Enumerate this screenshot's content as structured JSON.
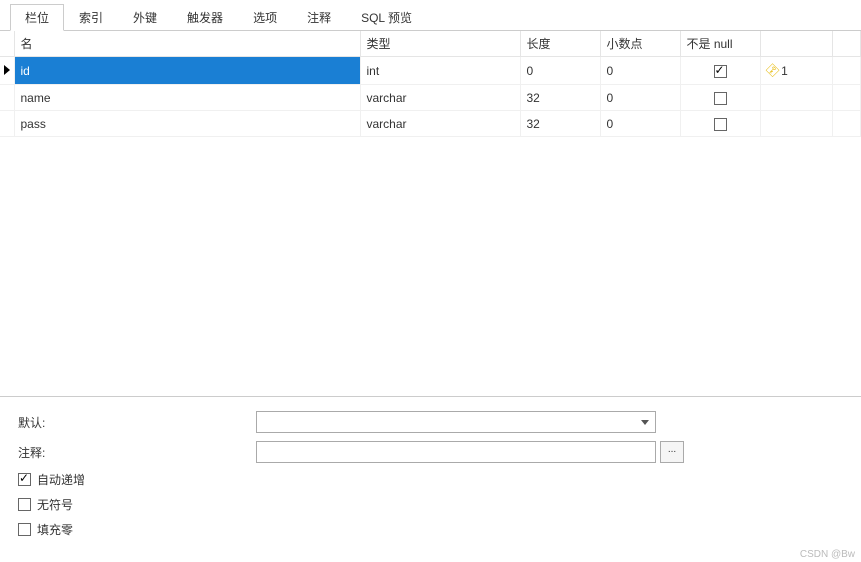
{
  "tabs": {
    "fields": "栏位",
    "indexes": "索引",
    "fk": "外键",
    "triggers": "触发器",
    "options": "选项",
    "comments": "注释",
    "sql": "SQL 预览"
  },
  "columns": {
    "name": "名",
    "type": "类型",
    "length": "长度",
    "decimals": "小数点",
    "notnull": "不是 null"
  },
  "rows": [
    {
      "name": "id",
      "type": "int",
      "length": "0",
      "decimals": "0",
      "notnull": true,
      "primary_key_order": "1",
      "selected": true
    },
    {
      "name": "name",
      "type": "varchar",
      "length": "32",
      "decimals": "0",
      "notnull": false,
      "primary_key_order": "",
      "selected": false
    },
    {
      "name": "pass",
      "type": "varchar",
      "length": "32",
      "decimals": "0",
      "notnull": false,
      "primary_key_order": "",
      "selected": false
    }
  ],
  "details": {
    "default_label": "默认:",
    "default_value": "",
    "comment_label": "注释:",
    "comment_value": "",
    "more_label": "...",
    "auto_increment_label": "自动递增",
    "auto_increment": true,
    "unsigned_label": "无符号",
    "unsigned": false,
    "zerofill_label": "填充零",
    "zerofill": false
  },
  "watermark": "CSDN @Bw"
}
